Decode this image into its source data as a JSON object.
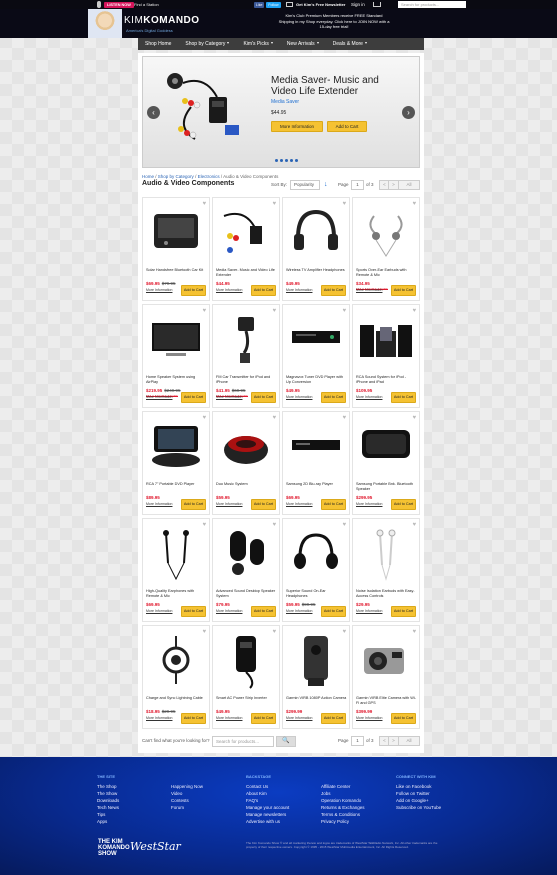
{
  "topbar": {
    "listen_label": "LISTEN NOW",
    "station_label": "Find a Station",
    "like_label": "Like",
    "like_count": "Like",
    "follow_label": "Follow",
    "newsletter_label": "Get Kim's Free Newsletter",
    "signin_label": "Sign in",
    "search_placeholder": "Search for products..."
  },
  "header": {
    "logo_first": "KIM",
    "logo_second": "KOMANDO",
    "tagline": "America's Digital Goddess",
    "promo": "Kim's Club Premium Members receive FREE Standard Shipping in my Shop everyday. Click here to JOIN NOW with a 15-day free trial!"
  },
  "nav": [
    {
      "label": "Shop Home",
      "caret": false
    },
    {
      "label": "Shop by Category",
      "caret": true
    },
    {
      "label": "Kim's Picks",
      "caret": true
    },
    {
      "label": "New Arrivals",
      "caret": true
    },
    {
      "label": "Deals & More",
      "caret": true
    }
  ],
  "slider": {
    "title": "Media Saver- Music and Video Life Extender",
    "brand": "Media Saver",
    "price": "$44.95",
    "more_label": "More Information",
    "add_label": "Add to Cart",
    "prev": "‹",
    "next": "›"
  },
  "breadcrumb": {
    "items": [
      "Home",
      "Shop by Category",
      "Electronics"
    ],
    "current": "Audio & Video Components"
  },
  "page_title": "Audio & Video Components",
  "sort": {
    "label": "Sort By:",
    "value": "Popularity",
    "direction": "↓",
    "page_label": "Page",
    "page": "1",
    "of_label": "of 3",
    "prev": "<",
    "next": ">",
    "all": "All"
  },
  "labels": {
    "more": "More Information",
    "add": "Add to Cart",
    "deal": "ONLY AT KIM'S STORE",
    "heart": "♥"
  },
  "products": [
    {
      "name": "Solar Handsfree Bluetooth Car Kit",
      "price": "$69.95",
      "old": "$79.95",
      "icon": "car-kit-icon"
    },
    {
      "name": "Media Saver- Music and Video Life Extender",
      "price": "$44.95",
      "old": "",
      "icon": "cable-icon"
    },
    {
      "name": "Wireless TV Amplifier Headphones",
      "price": "$49.95",
      "old": "",
      "icon": "headphones-icon"
    },
    {
      "name": "Sports Over-Ear Earbuds with Remote & Mic",
      "price": "$34.95",
      "old": "",
      "icon": "earbuds-icon",
      "deal": true
    },
    {
      "name": "Home Speaker System using AirPlay",
      "price": "$219.95",
      "old": "$249.95",
      "icon": "speaker-icon",
      "deal": true
    },
    {
      "name": "FM Car Transmitter for iPod and iPhone",
      "price": "$41.95",
      "old": "$69.95",
      "icon": "transmitter-icon",
      "deal": true
    },
    {
      "name": "Magnavox Tuner DVD Player with Up Conversion",
      "price": "$49.95",
      "old": "",
      "icon": "dvd-icon"
    },
    {
      "name": "RCA Sound System for iPod - iPhone and iPad",
      "price": "$109.95",
      "old": "",
      "icon": "sound-system-icon"
    },
    {
      "name": "RCA 7\" Portable DVD Player",
      "price": "$89.95",
      "old": "",
      "icon": "portable-dvd-icon"
    },
    {
      "name": "Duo Music System",
      "price": "$59.95",
      "old": "",
      "icon": "duo-speaker-icon"
    },
    {
      "name": "Samsung 2D Blu-ray Player",
      "price": "$69.95",
      "old": "",
      "icon": "bluray-icon"
    },
    {
      "name": "Samsung Portable Bnk. Bluetooth Speaker",
      "price": "$299.95",
      "old": "",
      "icon": "bt-speaker-icon"
    },
    {
      "name": "High-Quality Earphones with Remote & Mic",
      "price": "$69.95",
      "old": "",
      "icon": "earphones-icon"
    },
    {
      "name": "Advanced Sound Desktop Speaker System",
      "price": "$79.95",
      "old": "",
      "icon": "desktop-speaker-icon"
    },
    {
      "name": "Superior Sound On-Ear Headphones",
      "price": "$59.95",
      "old": "$99.95",
      "icon": "onear-icon"
    },
    {
      "name": "Noise Isolation Earbuds with Easy-Access Controls",
      "price": "$29.95",
      "old": "",
      "icon": "white-earbuds-icon"
    },
    {
      "name": "Charge and Sync Lightning Cable",
      "price": "$18.95",
      "old": "$29.95",
      "icon": "lightning-cable-icon"
    },
    {
      "name": "Smart AC Power Strip Inverter",
      "price": "$49.95",
      "old": "",
      "icon": "inverter-icon"
    },
    {
      "name": "Garmin VIRB 1080P Action Camera",
      "price": "$299.99",
      "old": "",
      "icon": "action-cam-icon"
    },
    {
      "name": "Garmin VIRB Elite Camera with Wi-Fi and GPS",
      "price": "$399.99",
      "old": "",
      "icon": "elite-cam-icon"
    }
  ],
  "bottom": {
    "question": "Can't find what you're looking for?",
    "search_placeholder": "Search for products...",
    "search_icon": "🔍"
  },
  "footer": {
    "col1": {
      "heading": "THE SITE",
      "items": [
        "The Shop",
        "The Show",
        "Downloads",
        "Tech News",
        "Tips",
        "Apps"
      ]
    },
    "col2": {
      "heading": "",
      "items": [
        "Happening Now",
        "Video",
        "Contests",
        "Forum"
      ]
    },
    "col3": {
      "heading": "BACKSTAGE",
      "items": [
        "Contact Us",
        "About Kim",
        "FAQ's",
        "Manage your account",
        "Manage newsletters",
        "Advertise with us"
      ]
    },
    "col4": {
      "heading": "",
      "items": [
        "Affiliate Center",
        "Jobs",
        "Operation Komando",
        "Returns & Exchanges",
        "Terms & Conditions",
        "Privacy Policy"
      ]
    },
    "col5": {
      "heading": "CONNECT WITH KIM",
      "items": [
        "Like on Facebook",
        "Follow on Twitter",
        "Add on Google+",
        "Subscribe on YouTube"
      ]
    },
    "logo1": "THE KIM KOMANDO SHOW",
    "logo2": "WestStar",
    "legal": "The Kim Komando Show ® and all marketing thereto and logos are trademarks of WestStar TalkRadio Network, Inc. All other trademarks are the property of their respective owners. Copyright © 1995 - 2015 WestStar Multimedia Entertainment, Inc. All Rights Reserved."
  },
  "colors": {
    "accent": "#f5c232",
    "price": "#e0182d",
    "link": "#2a64b5",
    "footer": "#082a90"
  }
}
